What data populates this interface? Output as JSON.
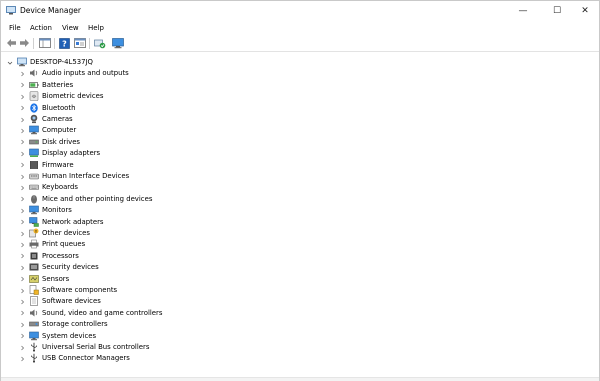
{
  "window": {
    "title": "Device Manager",
    "minimize_glyph": "—",
    "maximize_glyph": "☐",
    "close_glyph": "✕"
  },
  "menu": [
    "File",
    "Action",
    "View",
    "Help"
  ],
  "toolbar": {
    "buttons": [
      "back-arrow-icon",
      "forward-arrow-icon",
      "show-hide-console-tree-icon",
      "help-icon",
      "properties-icon",
      "scan-hardware-changes-icon",
      "update-driver-icon"
    ]
  },
  "tree": {
    "root": "DESKTOP-4L537JQ",
    "items": [
      {
        "label": "Audio inputs and outputs",
        "icon": "speaker-icon"
      },
      {
        "label": "Batteries",
        "icon": "battery-icon"
      },
      {
        "label": "Biometric devices",
        "icon": "biometric-icon"
      },
      {
        "label": "Bluetooth",
        "icon": "bluetooth-icon"
      },
      {
        "label": "Cameras",
        "icon": "camera-icon"
      },
      {
        "label": "Computer",
        "icon": "computer-icon"
      },
      {
        "label": "Disk drives",
        "icon": "disk-drive-icon"
      },
      {
        "label": "Display adapters",
        "icon": "display-adapter-icon"
      },
      {
        "label": "Firmware",
        "icon": "firmware-icon"
      },
      {
        "label": "Human Interface Devices",
        "icon": "hid-icon"
      },
      {
        "label": "Keyboards",
        "icon": "keyboard-icon"
      },
      {
        "label": "Mice and other pointing devices",
        "icon": "mouse-icon"
      },
      {
        "label": "Monitors",
        "icon": "monitor-icon"
      },
      {
        "label": "Network adapters",
        "icon": "network-adapter-icon"
      },
      {
        "label": "Other devices",
        "icon": "other-devices-icon"
      },
      {
        "label": "Print queues",
        "icon": "printer-icon"
      },
      {
        "label": "Processors",
        "icon": "processor-icon"
      },
      {
        "label": "Security devices",
        "icon": "security-device-icon"
      },
      {
        "label": "Sensors",
        "icon": "sensor-icon"
      },
      {
        "label": "Software components",
        "icon": "software-component-icon"
      },
      {
        "label": "Software devices",
        "icon": "software-device-icon"
      },
      {
        "label": "Sound, video and game controllers",
        "icon": "sound-controller-icon"
      },
      {
        "label": "Storage controllers",
        "icon": "storage-controller-icon"
      },
      {
        "label": "System devices",
        "icon": "system-device-icon"
      },
      {
        "label": "Universal Serial Bus controllers",
        "icon": "usb-controller-icon"
      },
      {
        "label": "USB Connector Managers",
        "icon": "usb-connector-icon"
      }
    ]
  },
  "colors": {
    "accent_blue": "#1f6fd1",
    "bluetooth_blue": "#1a73e8",
    "chevron_gray": "#666666"
  }
}
